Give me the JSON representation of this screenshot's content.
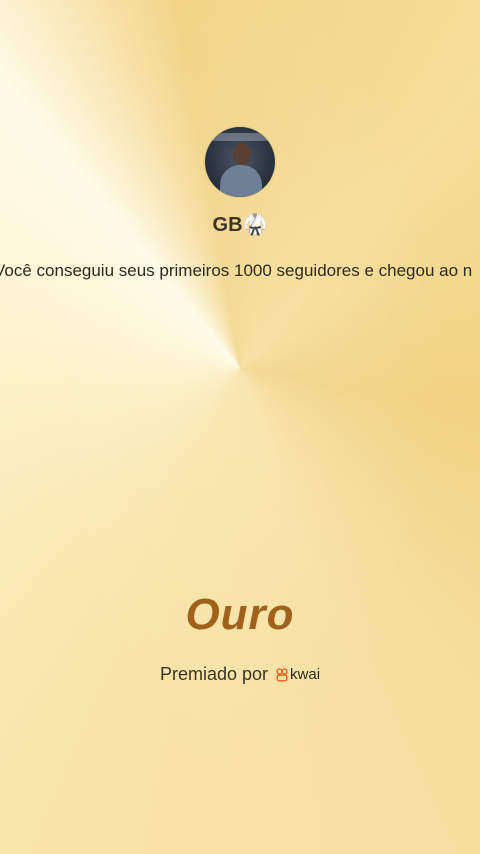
{
  "user": {
    "name": "GB🥋",
    "avatar_icon": "profile-photo"
  },
  "message": "Você conseguiu seus primeiros 1000 seguidores e chegou ao n",
  "award": {
    "title": "Ouro"
  },
  "footer": {
    "label": "Premiado por",
    "brand": "kwai",
    "brand_color": "#ff5a1f"
  },
  "colors": {
    "background": "#f6dc92",
    "title": "#a0611a"
  }
}
